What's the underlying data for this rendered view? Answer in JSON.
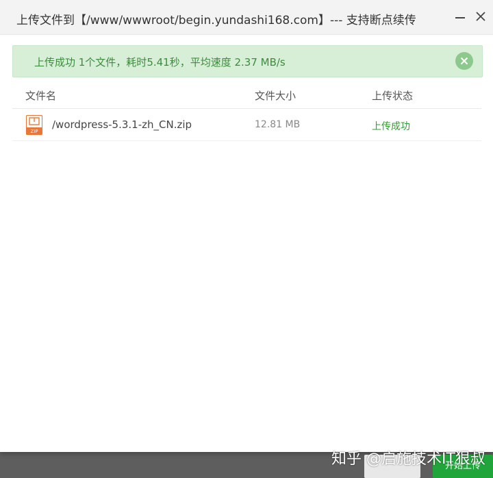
{
  "dialog": {
    "title": "上传文件到【/www/wwwroot/begin.yundashi168.com】--- 支持断点续传"
  },
  "alert": {
    "message": "上传成功 1个文件，耗时5.41秒，平均速度 2.37 MB/s"
  },
  "table": {
    "headers": {
      "name": "文件名",
      "size": "文件大小",
      "status": "上传状态"
    },
    "rows": [
      {
        "name": "/wordpress-5.3.1-zh_CN.zip",
        "size": "12.81 MB",
        "status": "上传成功",
        "icon": "zip-file-icon",
        "icon_label": "ZIP"
      }
    ]
  },
  "footer": {
    "start_upload_label": "开始上传"
  },
  "watermark": "知乎 @启施技术IT狠叔",
  "colors": {
    "success_bg": "#d6efd6",
    "success_text": "#3d8b3d",
    "status_success": "#2e9e2e",
    "primary_button": "#20a53a",
    "zip_icon": "#e8783a"
  }
}
